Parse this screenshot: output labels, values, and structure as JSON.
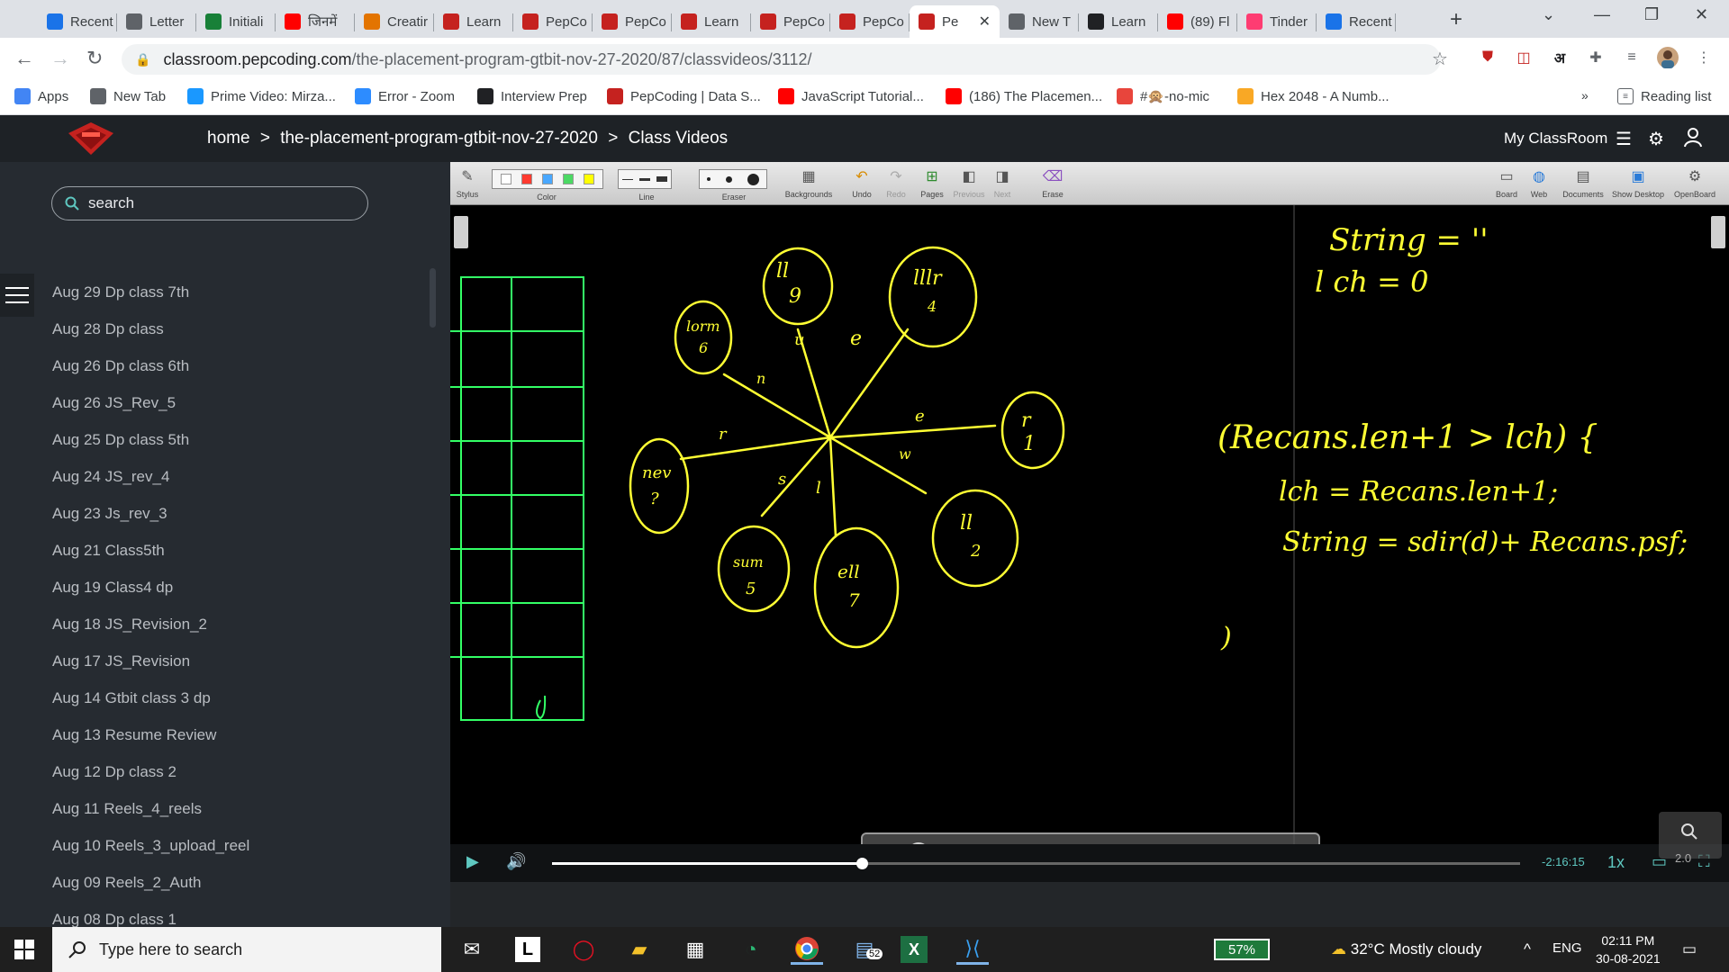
{
  "tabs": [
    {
      "label": "Recent",
      "icon": "google-drive-icon",
      "color": "#1a73e8"
    },
    {
      "label": "Letter",
      "icon": "compass-icon",
      "color": "#5f6368"
    },
    {
      "label": "Initiali",
      "icon": "infinity-icon",
      "color": "#188038"
    },
    {
      "label": "जिनमें",
      "icon": "youtube-icon",
      "color": "#ff0000"
    },
    {
      "label": "Creatir",
      "icon": "avatar-icon",
      "color": "#e37400"
    },
    {
      "label": "Learn",
      "icon": "pepcoding-icon",
      "color": "#c5221f"
    },
    {
      "label": "PepCo",
      "icon": "pepcoding-icon",
      "color": "#c5221f"
    },
    {
      "label": "PepCo",
      "icon": "pepcoding-icon",
      "color": "#c5221f"
    },
    {
      "label": "Learn",
      "icon": "pepcoding-icon",
      "color": "#c5221f"
    },
    {
      "label": "PepCo",
      "icon": "pepcoding-icon",
      "color": "#c5221f"
    },
    {
      "label": "PepCo",
      "icon": "pepcoding-icon",
      "color": "#c5221f"
    },
    {
      "label": "Pe",
      "icon": "pepcoding-icon",
      "color": "#c5221f",
      "active": true
    },
    {
      "label": "New T",
      "icon": "chrome-icon",
      "color": "#5f6368"
    },
    {
      "label": "Learn",
      "icon": "codechef-icon",
      "color": "#202124"
    },
    {
      "label": "(89) Fl",
      "icon": "youtube-icon",
      "color": "#ff0000"
    },
    {
      "label": "Tinder",
      "icon": "flame-icon",
      "color": "#fe3c72"
    },
    {
      "label": "Recent",
      "icon": "google-drive-icon",
      "color": "#1a73e8"
    }
  ],
  "address": {
    "host": "classroom.pepcoding.com",
    "path": "/the-placement-program-gtbit-nov-27-2020/87/classvideos/3112/"
  },
  "bookmarks": [
    {
      "label": "Apps",
      "icon": "apps-grid-icon",
      "color": "#4285f4"
    },
    {
      "label": "New Tab",
      "icon": "chrome-icon",
      "color": "#5f6368"
    },
    {
      "label": "Prime Video: Mirza...",
      "icon": "prime-video-icon",
      "color": "#1a98ff"
    },
    {
      "label": "Error - Zoom",
      "icon": "zoom-icon",
      "color": "#2d8cff"
    },
    {
      "label": "Interview Prep",
      "icon": "td-icon",
      "color": "#202124"
    },
    {
      "label": "PepCoding | Data S...",
      "icon": "pepcoding-icon",
      "color": "#c5221f"
    },
    {
      "label": "JavaScript Tutorial...",
      "icon": "youtube-icon",
      "color": "#ff0000"
    },
    {
      "label": "(186) The Placemen...",
      "icon": "youtube-icon",
      "color": "#ff0000"
    },
    {
      "label": "#🙊-no-mic",
      "icon": "badge-136-icon",
      "color": "#e8453c"
    },
    {
      "label": "Hex 2048 - A Numb...",
      "icon": "hex-icon",
      "color": "#f9a825"
    }
  ],
  "bookmarks_more": "»",
  "reading_list": "Reading list",
  "site": {
    "breadcrumb": [
      "home",
      "the-placement-program-gtbit-nov-27-2020",
      "Class Videos"
    ],
    "breadcrumb_sep": ">",
    "my_classroom": "My ClassRoom"
  },
  "sidebar": {
    "search_placeholder": "search",
    "videos": [
      "Aug 29 Dp class 7th",
      "Aug 28 Dp class",
      "Aug 26 Dp class 6th",
      "Aug 26 JS_Rev_5",
      "Aug 25 Dp class 5th",
      "Aug 24 JS_rev_4",
      "Aug 23 Js_rev_3",
      "Aug 21 Class5th",
      "Aug 19 Class4 dp",
      "Aug 18 JS_Revision_2",
      "Aug 17 JS_Revision",
      "Aug 14 Gtbit class 3 dp",
      "Aug 13 Resume Review",
      "Aug 12 Dp class 2",
      "Aug 11 Reels_4_reels",
      "Aug 10 Reels_3_upload_reel",
      "Aug 09 Reels_2_Auth",
      "Aug 08 Dp class 1"
    ]
  },
  "whiteboard": {
    "tools": {
      "stylus": "Stylus",
      "color": "Color",
      "line": "Line",
      "eraser": "Eraser",
      "backgrounds": "Backgrounds",
      "undo": "Undo",
      "redo": "Redo",
      "pages": "Pages",
      "previous": "Previous",
      "next": "Next",
      "erase": "Erase",
      "board": "Board",
      "web": "Web",
      "documents": "Documents",
      "show_desktop": "Show Desktop",
      "openboard": "OpenBoard"
    },
    "palette": [
      "#ffffff",
      "#ff3b30",
      "#4aa8ff",
      "#4cd964",
      "#ffff00"
    ],
    "ink_color": "#ffff33",
    "grid_color": "#33ff66"
  },
  "player": {
    "time_remaining": "-2:16:15",
    "speed": "1x",
    "zoom": "2.0",
    "progress_fraction": 0.32
  },
  "taskbar": {
    "search_placeholder": "Type here to search",
    "badge_count": "52",
    "battery": "57%",
    "weather": "32°C  Mostly cloudy",
    "lang": "ENG",
    "time": "02:11 PM",
    "date": "30-08-2021"
  }
}
